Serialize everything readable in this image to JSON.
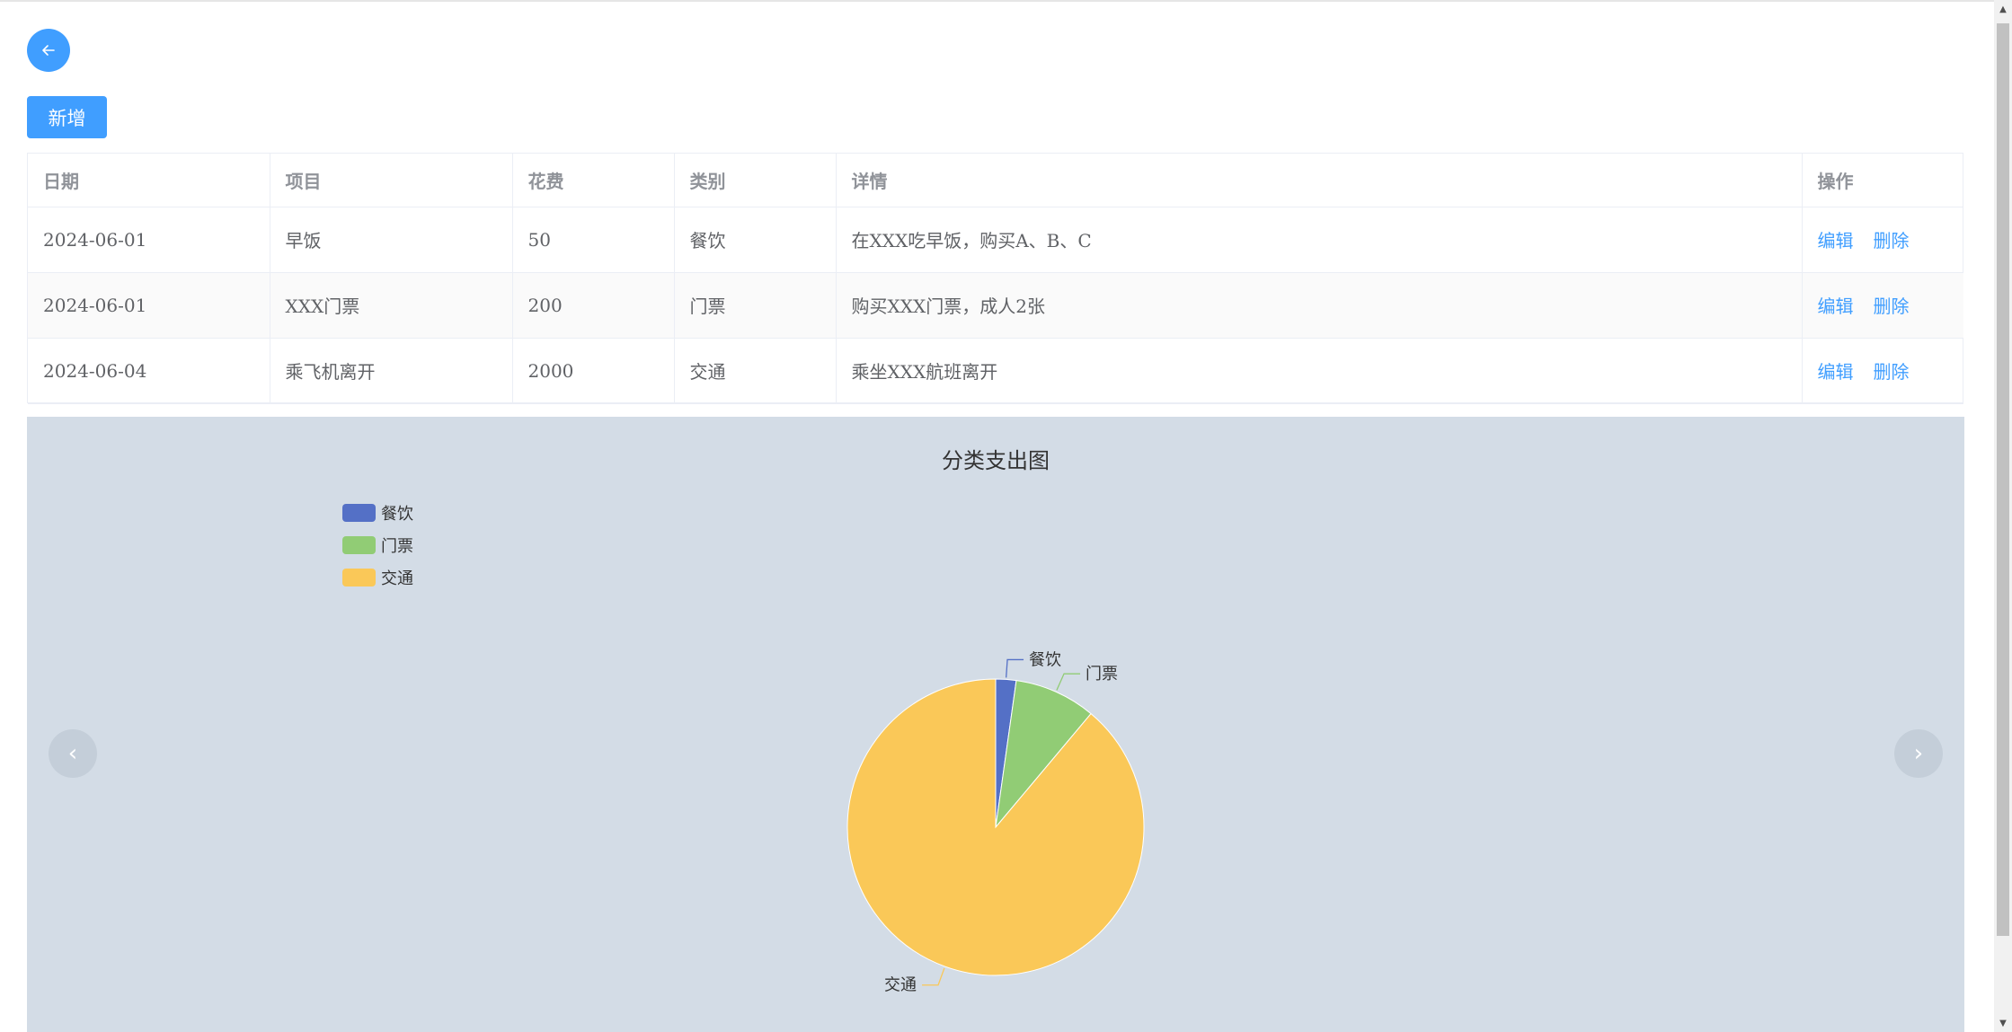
{
  "toolbar": {
    "back_icon": "arrow-left-icon",
    "add_label": "新增"
  },
  "table": {
    "columns": [
      "日期",
      "项目",
      "花费",
      "类别",
      "详情",
      "操作"
    ],
    "rows": [
      {
        "date": "2024-06-01",
        "item": "早饭",
        "cost": "50",
        "category": "餐饮",
        "detail": "在XXX吃早饭，购买A、B、C",
        "edit": "编辑",
        "delete": "删除"
      },
      {
        "date": "2024-06-01",
        "item": "XXX门票",
        "cost": "200",
        "category": "门票",
        "detail": "购买XXX门票，成人2张",
        "edit": "编辑",
        "delete": "删除"
      },
      {
        "date": "2024-06-04",
        "item": "乘飞机离开",
        "cost": "2000",
        "category": "交通",
        "detail": "乘坐XXX航班离开",
        "edit": "编辑",
        "delete": "删除"
      }
    ]
  },
  "carousel": {
    "prev_icon": "chevron-left-icon",
    "next_icon": "chevron-right-icon"
  },
  "chart_data": {
    "type": "pie",
    "title": "分类支出图",
    "categories": [
      "餐饮",
      "门票",
      "交通"
    ],
    "values": [
      50,
      200,
      2000
    ],
    "colors": [
      "#5470c6",
      "#91cc75",
      "#fac858"
    ],
    "legend": {
      "position": "top-left",
      "entries": [
        "餐饮",
        "门票",
        "交通"
      ]
    }
  }
}
